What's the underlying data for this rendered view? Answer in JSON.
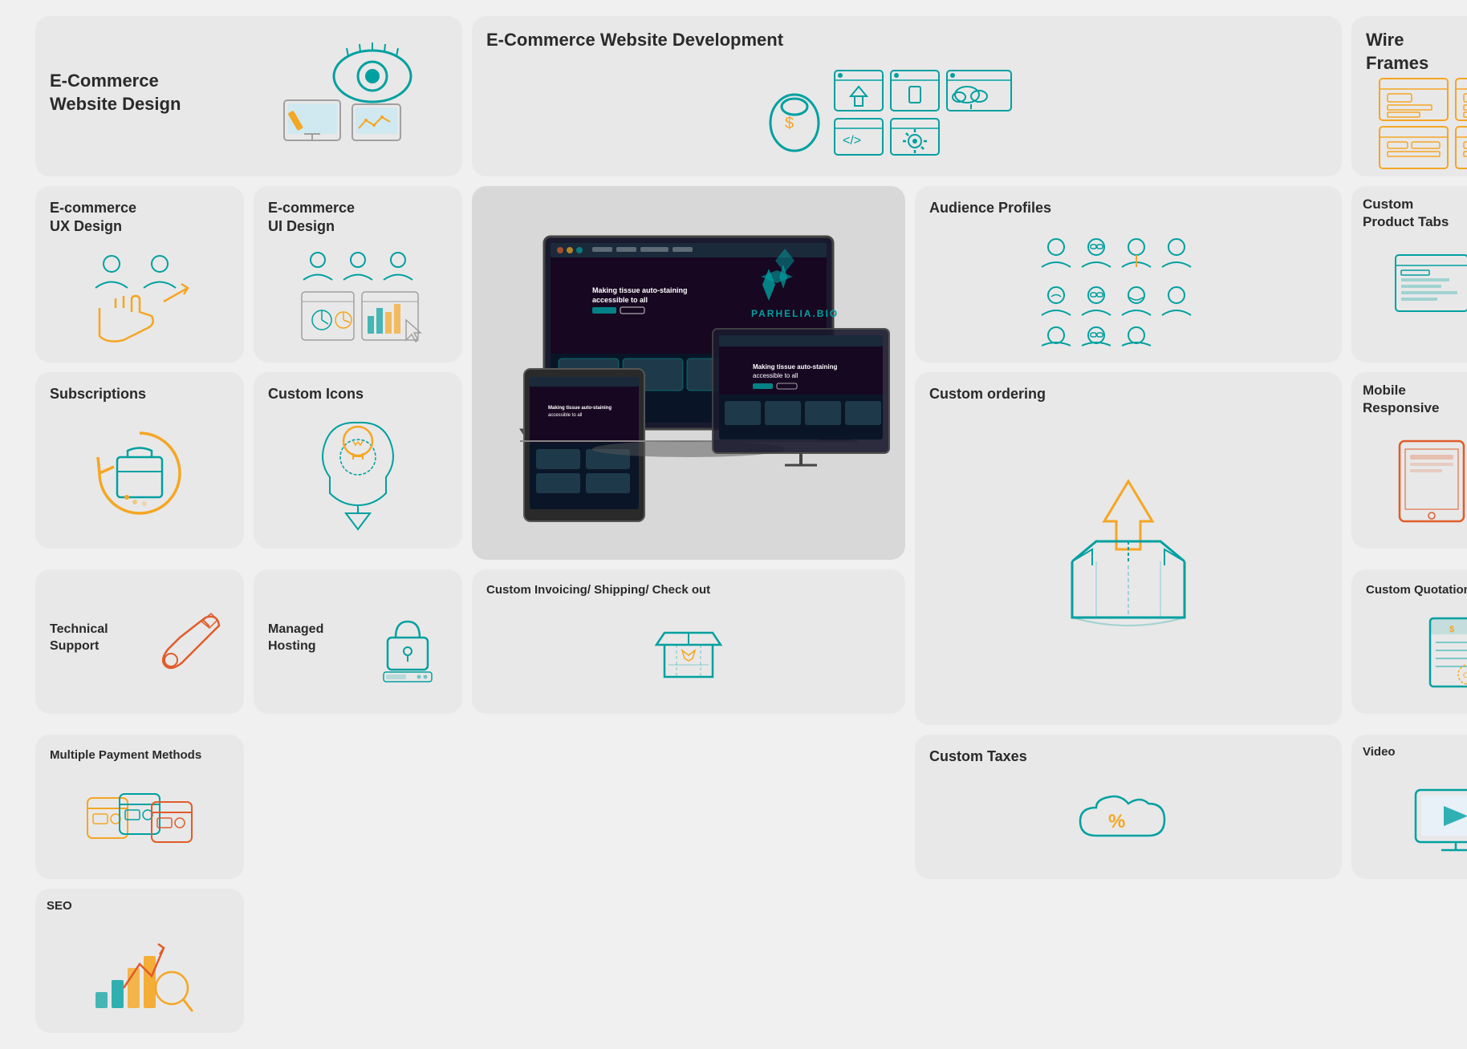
{
  "cards": {
    "ecommerce_design": {
      "title": "E-Commerce\nWebsite Design",
      "color_accent": "#00a0a0"
    },
    "ecommerce_dev": {
      "title": "E-Commerce Website Development",
      "color_accent": "#00a0a0"
    },
    "wireframes": {
      "title": "Wire\nFrames",
      "color_accent": "#f5a623"
    },
    "ux_design": {
      "title": "E-commerce\nUX Design",
      "color_accent": "#00a0a0"
    },
    "ui_design": {
      "title": "E-commerce\nUI Design",
      "color_accent": "#00a0a0"
    },
    "audience_profiles": {
      "title": "Audience Profiles",
      "color_accent": "#00a0a0"
    },
    "custom_product_tabs": {
      "title": "Custom\nProduct Tabs",
      "color_accent": "#00a0a0"
    },
    "subscriptions": {
      "title": "Subscriptions",
      "color_accent": "#00a0a0"
    },
    "custom_icons": {
      "title": "Custom Icons",
      "color_accent": "#f5a623"
    },
    "custom_ordering": {
      "title": "Custom ordering",
      "color_accent": "#f5a623"
    },
    "mobile_responsive": {
      "title": "Mobile\nResponsive",
      "color_accent": "#e05c2a"
    },
    "technical_support": {
      "title": "Technical Support",
      "color_accent": "#e05c2a"
    },
    "managed_hosting": {
      "title": "Managed Hosting",
      "color_accent": "#00a0a0"
    },
    "custom_invoicing": {
      "title": "Custom Invoicing/ Shipping/ Check out",
      "color_accent": "#00a0a0"
    },
    "custom_quotation": {
      "title": "Custom Quotation",
      "color_accent": "#00a0a0"
    },
    "multiple_payment": {
      "title": "Multiple Payment Methods",
      "color_accent": "#00a0a0"
    },
    "custom_taxes": {
      "title": "Custom Taxes",
      "color_accent": "#00a0a0"
    },
    "seo": {
      "title": "SEO",
      "color_accent": "#00a0a0"
    },
    "video": {
      "title": "Video",
      "color_accent": "#00a0a0"
    },
    "center_brand": {
      "brand_name": "PARHELIA.BIO"
    }
  }
}
